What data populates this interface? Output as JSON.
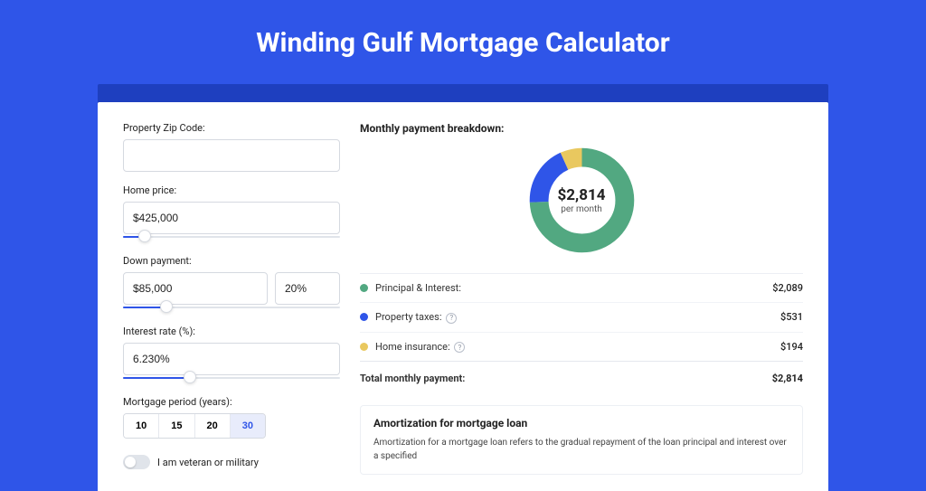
{
  "header": {
    "title": "Winding Gulf Mortgage Calculator"
  },
  "form": {
    "zip_label": "Property Zip Code:",
    "zip_value": "",
    "home_price_label": "Home price:",
    "home_price_value": "$425,000",
    "home_price_pct": 10,
    "down_label": "Down payment:",
    "down_value": "$85,000",
    "down_pct_value": "20%",
    "down_slider_pct": 20,
    "rate_label": "Interest rate (%):",
    "rate_value": "6.230%",
    "rate_slider_pct": 31,
    "period_label": "Mortgage period (years):",
    "periods": [
      "10",
      "15",
      "20",
      "30"
    ],
    "period_active": "30",
    "veteran_label": "I am veteran or military"
  },
  "breakdown": {
    "title": "Monthly payment breakdown:",
    "center_value": "$2,814",
    "center_sub": "per month",
    "items": [
      {
        "key": "pi",
        "label": "Principal & Interest:",
        "value": "$2,089",
        "color": "#52A881",
        "help": false
      },
      {
        "key": "tax",
        "label": "Property taxes:",
        "value": "$531",
        "color": "#2F55E8",
        "help": true
      },
      {
        "key": "ins",
        "label": "Home insurance:",
        "value": "$194",
        "color": "#E9C85F",
        "help": true
      }
    ],
    "total_label": "Total monthly payment:",
    "total_value": "$2,814"
  },
  "amort": {
    "heading": "Amortization for mortgage loan",
    "text": "Amortization for a mortgage loan refers to the gradual repayment of the loan principal and interest over a specified"
  },
  "chart_data": {
    "type": "pie",
    "title": "Monthly payment breakdown",
    "categories": [
      "Principal & Interest",
      "Property taxes",
      "Home insurance"
    ],
    "values": [
      2089,
      531,
      194
    ],
    "colors": [
      "#52A881",
      "#2F55E8",
      "#E9C85F"
    ],
    "total": 2814
  }
}
